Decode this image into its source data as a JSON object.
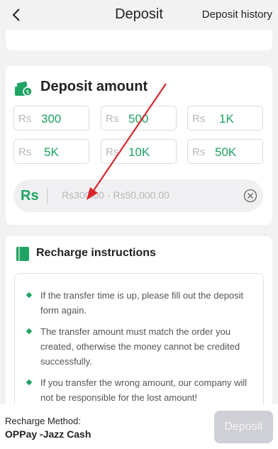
{
  "header": {
    "title": "Deposit",
    "history_label": "Deposit history"
  },
  "deposit_amount": {
    "title": "Deposit amount",
    "currency": "Rs",
    "presets": [
      "300",
      "500",
      "1K",
      "5K",
      "10K",
      "50K"
    ],
    "input_prefix": "Rs",
    "input_placeholder": "Rs300.00 - Rs50,000.00"
  },
  "instructions": {
    "title": "Recharge instructions",
    "items": [
      "If the transfer time is up, please fill out the deposit form again.",
      "The transfer amount must match the order you created, otherwise the money cannot be credited successfully.",
      "If you transfer the wrong amount, our company will not be responsible for the lost amount!"
    ]
  },
  "footer": {
    "method_label": "Recharge Method:",
    "method_value": "OPPay -Jazz Cash",
    "deposit_label": "Deposit"
  },
  "colors": {
    "accent": "#1fa363",
    "background": "#f2f2f3",
    "disabled_button": "#cfd0d6",
    "annotation_arrow": "#d9262c"
  },
  "icons": {
    "back": "chevron-left-icon",
    "deposit_section": "wallet-cash-icon",
    "clear": "circle-x-icon",
    "instructions": "book-icon",
    "bullet": "diamond-bullet-icon"
  }
}
